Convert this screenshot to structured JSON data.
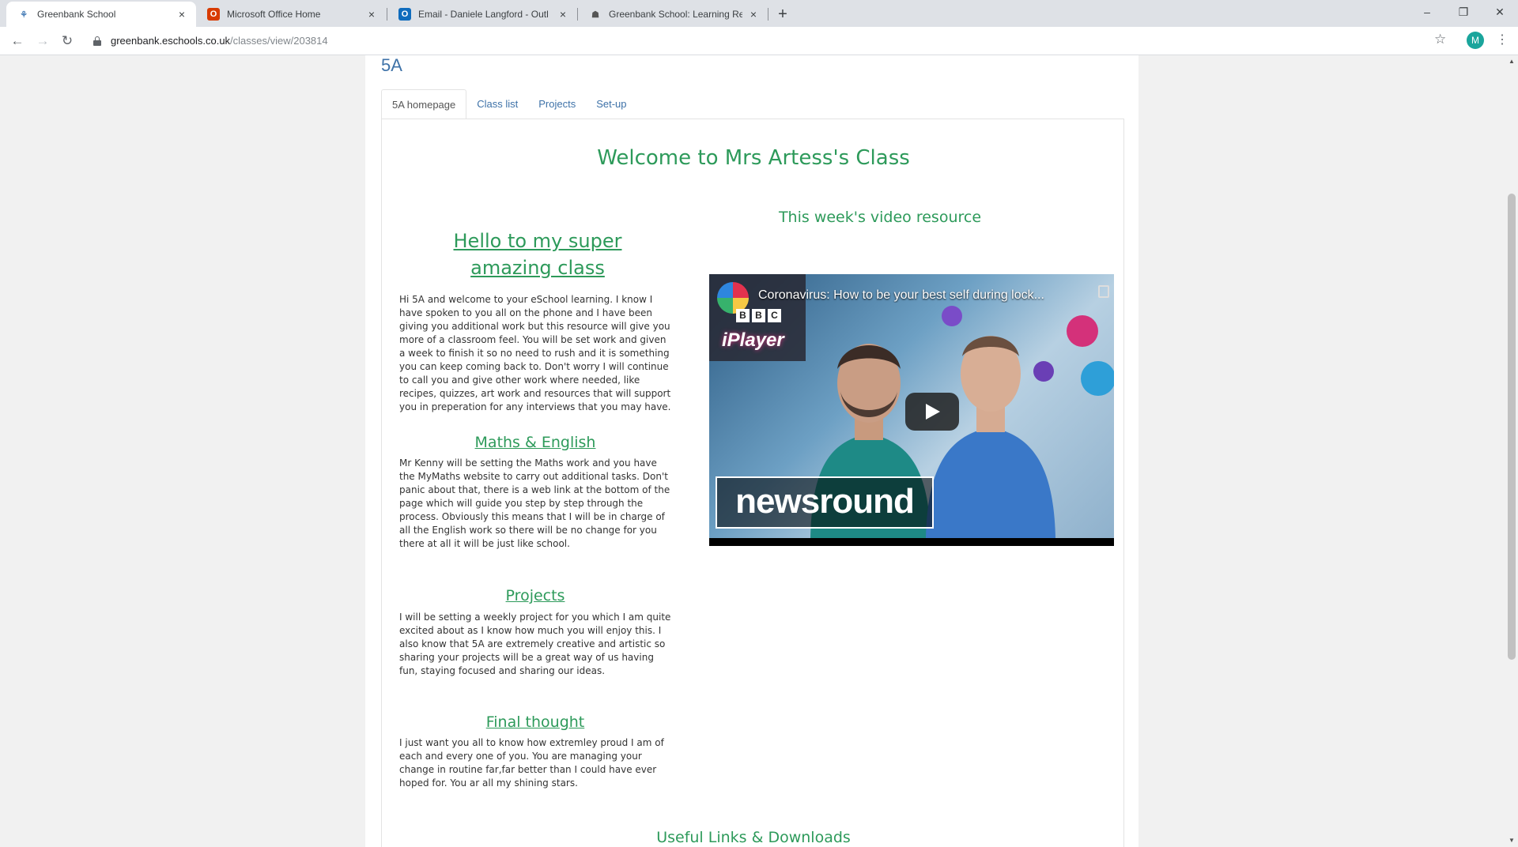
{
  "browser": {
    "tabs": [
      {
        "title": "Greenbank School",
        "icon": "school-favicon",
        "active": true
      },
      {
        "title": "Microsoft Office Home",
        "icon": "office-icon",
        "active": false
      },
      {
        "title": "Email - Daniele Langford - Outl",
        "icon": "outlook-icon",
        "active": false
      },
      {
        "title": "Greenbank School: Learning Res",
        "icon": "learning-icon",
        "active": false
      }
    ],
    "new_tab": "+",
    "url_host": "greenbank.eschools.co.uk",
    "url_path": "/classes/view/203814",
    "profile_initial": "M",
    "controls": {
      "minimize": "–",
      "maximize": "❐",
      "close": "✕"
    }
  },
  "page": {
    "class_name": "5A",
    "tabs": [
      "5A homepage",
      "Class list",
      "Projects",
      "Set-up"
    ],
    "welcome": "Welcome to Mrs Artess's Class",
    "video_heading": "This week's video resource",
    "hello_heading": "Hello to my super amazing class",
    "intro": "Hi 5A and welcome to your eSchool learning. I know I have spoken to you all on the phone and I have been giving you additional work but this resource will give you more of a classroom feel. You will be set work and given a week to finish it so no need to rush and it is something you can keep coming back to. Don't worry I will continue to call you and give other work where needed, like recipes, quizzes, art work and resources that will support you in preperation for any interviews that you may have.",
    "sections": [
      {
        "heading": "Maths & English",
        "body": "Mr Kenny will be setting the Maths work and you have the MyMaths website to carry out additional tasks. Don't panic about that, there is a web link at the bottom of the page which will guide you step by step through the process.  Obviously this means that I will be in charge of all the English work so there will be no change for you there at all it will be just like school."
      },
      {
        "heading": "Projects",
        "body": "I will be setting a weekly project for you which I am quite excited about as I know how much you will enjoy this. I also know that 5A are extremely creative and artistic so sharing your projects will be a great way of us having fun, staying focused and sharing our ideas."
      },
      {
        "heading": "Final thought",
        "body": "I just want you all to know how extremley proud I am of each and every one of you. You are managing your change in routine far,far better than I could have ever hoped for. You ar all my shining stars."
      }
    ],
    "useful_links": "Useful Links & Downloads",
    "video": {
      "caption": "Coronavirus: How to be your best self during lock...",
      "bbc_letters": [
        "B",
        "B",
        "C"
      ],
      "iplayer": "iPlayer",
      "brand": "newsround"
    }
  },
  "colors": {
    "accent_green": "#2d9a5a",
    "link_blue": "#3e72a8"
  }
}
